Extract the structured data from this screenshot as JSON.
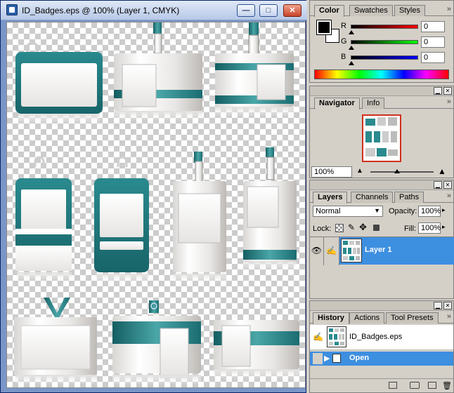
{
  "document": {
    "title": "ID_Badges.eps @ 100% (Layer 1, CMYK)",
    "minimize_label": "—",
    "restore_label": "□",
    "close_label": "✕"
  },
  "color_panel": {
    "tabs": [
      "Color",
      "Swatches",
      "Styles"
    ],
    "channels": [
      {
        "label": "R",
        "value": "0"
      },
      {
        "label": "G",
        "value": "0"
      },
      {
        "label": "B",
        "value": "0"
      }
    ],
    "more": "»"
  },
  "navigator_panel": {
    "tabs": [
      "Navigator",
      "Info"
    ],
    "zoom": "100%",
    "more": "»"
  },
  "layers_panel": {
    "tabs": [
      "Layers",
      "Channels",
      "Paths"
    ],
    "blend_mode": "Normal",
    "opacity_label": "Opacity:",
    "opacity_value": "100%",
    "lock_label": "Lock:",
    "fill_label": "Fill:",
    "fill_value": "100%",
    "layer_name": "Layer 1",
    "more": "»"
  },
  "history_panel": {
    "tabs": [
      "History",
      "Actions",
      "Tool Presets"
    ],
    "snapshot_name": "ID_Badges.eps",
    "state_name": "Open",
    "more": "»"
  },
  "colors": {
    "teal": "#1f7a7e",
    "selection": "#3d8fe0"
  }
}
